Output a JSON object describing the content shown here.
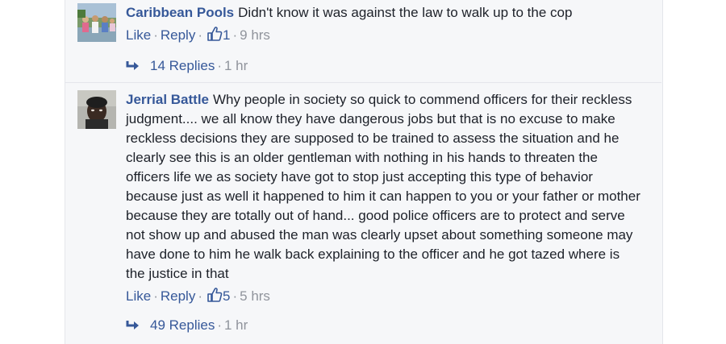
{
  "comments": [
    {
      "author": "Caribbean Pools",
      "text": "Didn't know it was against the law to walk up to the cop",
      "like_label": "Like",
      "reply_label": "Reply",
      "like_count": "1",
      "time": "9 hrs",
      "replies_label": "14 Replies",
      "replies_time": "1 hr"
    },
    {
      "author": "Jerrial Battle",
      "text": "Why people in society so quick to commend officers for their reckless judgment.... we all know they have dangerous jobs but that is no excuse to make reckless decisions they are supposed to be trained to assess the situation and he clearly see this is an older gentleman with nothing in his hands to threaten the officers life we as society have got to stop just accepting this type of behavior because just as well it happened to him it can happen to you or your father or mother because they are totally out of hand... good police officers are to protect and serve not show up and abused the man was clearly upset about something someone may have done to him he walk back explaining to the officer and he got tazed where is the justice in that",
      "like_label": "Like",
      "reply_label": "Reply",
      "like_count": "5",
      "time": "5 hrs",
      "replies_label": "49 Replies",
      "replies_time": "1 hr"
    }
  ],
  "separator": "·",
  "colors": {
    "link": "#365899",
    "meta": "#90949c",
    "text": "#1d2129",
    "panel": "#f6f7f9"
  },
  "icons": {
    "like": "thumbs-up-icon",
    "reply_arrow": "reply-arrow-icon"
  }
}
